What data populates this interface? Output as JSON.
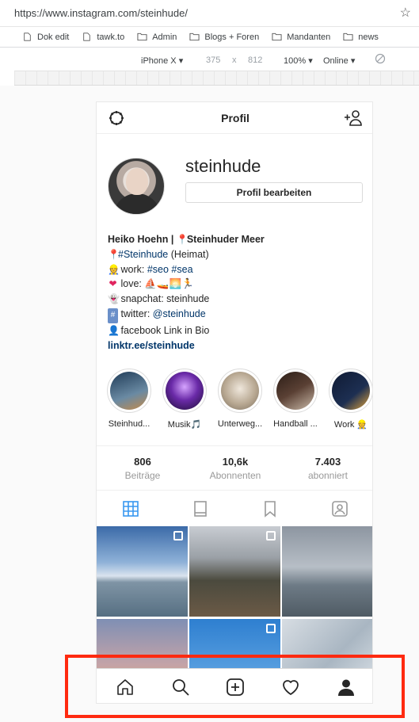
{
  "browser": {
    "url": "https://www.instagram.com/steinhude/",
    "bookmarks": [
      {
        "label": "Dok edit",
        "icon": "page-icon"
      },
      {
        "label": "tawk.to",
        "icon": "page-icon"
      },
      {
        "label": "Admin",
        "icon": "folder-icon"
      },
      {
        "label": "Blogs + Foren",
        "icon": "folder-icon"
      },
      {
        "label": "Mandanten",
        "icon": "folder-icon"
      },
      {
        "label": "news",
        "icon": "folder-icon"
      }
    ],
    "devtools": {
      "device": "iPhone X ▾",
      "width": "375",
      "times": "x",
      "height": "812",
      "zoom": "100% ▾",
      "network": "Online ▾"
    }
  },
  "profile": {
    "header_title": "Profil",
    "username": "steinhude",
    "edit_button": "Profil bearbeiten",
    "bio": {
      "name_line": "Heiko Hoehn | ",
      "pin_emoji": "📍",
      "name_line_rest": "Steinhuder Meer",
      "line2_tag": "#Steinhude",
      "line2_rest": " (Heimat)",
      "line3_prefix": "work: ",
      "line3_tag1": "#seo",
      "line3_tag2": "#sea",
      "line4": "love: ⛵🚤🌅🏃",
      "line5": "snapchat: steinhude",
      "line6_prefix": "twitter: ",
      "line6_mention": "@steinhude",
      "line7": "facebook Link in Bio",
      "link": "linktr.ee/steinhude"
    },
    "highlights": [
      {
        "label": "Steinhud...",
        "color": "#2f5a7a"
      },
      {
        "label": "Musik🎵",
        "color": "#6a2aa8"
      },
      {
        "label": "Unterweg...",
        "color": "#b8a892"
      },
      {
        "label": "Handball ...",
        "color": "#5a4034"
      },
      {
        "label": "Work 👷",
        "color": "#1d2f52"
      }
    ],
    "stats": [
      {
        "value": "806",
        "label": "Beiträge"
      },
      {
        "value": "10,6k",
        "label": "Abonnenten"
      },
      {
        "value": "7.403",
        "label": "abonniert"
      }
    ],
    "accent": "#3897f0"
  }
}
